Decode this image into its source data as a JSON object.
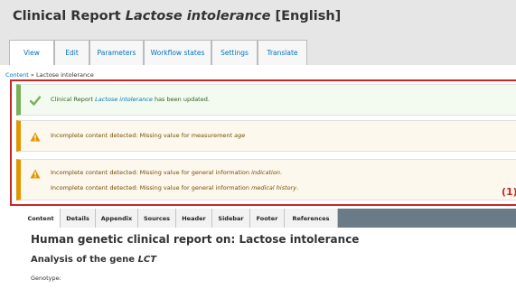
{
  "header": {
    "title_prefix": "Clinical Report ",
    "title_emphasis": "Lactose intolerance",
    "title_suffix": " [English]"
  },
  "tabs": [
    {
      "label": "View",
      "active": true
    },
    {
      "label": "Edit"
    },
    {
      "label": "Parameters"
    },
    {
      "label": "Workflow states"
    },
    {
      "label": "Settings"
    },
    {
      "label": "Translate"
    }
  ],
  "breadcrumb": {
    "link": "Content",
    "separator": " » ",
    "current": "Lactose intolerance"
  },
  "messages": {
    "status": {
      "prefix": "Clinical Report ",
      "emphasis": "Lactose intolerance",
      "suffix": " has been updated."
    },
    "warning1": {
      "prefix": "Incomplete content detected: Missing value for measurement ",
      "emphasis": "age"
    },
    "warning2_line1": {
      "prefix": "Incomplete content detected: Missing value for general information ",
      "emphasis": "indication",
      "suffix": "."
    },
    "warning2_line2": {
      "prefix": "Incomplete content detected: Missing value for general information ",
      "emphasis": "medical history",
      "suffix": "."
    }
  },
  "annotation": "(1)",
  "content_tabs": [
    "Content",
    "Details",
    "Appendix",
    "Sources",
    "Header",
    "Sidebar",
    "Footer",
    "References"
  ],
  "report": {
    "title": "Human genetic clinical report on: Lactose intolerance",
    "gene_prefix": "Analysis of the gene ",
    "gene_name": "LCT",
    "genotype_label": "Genotype:"
  },
  "colors": {
    "link": "#0074bd",
    "status_accent": "#77b259",
    "warning_accent": "#e09600",
    "highlight": "#c62828"
  },
  "icons": {
    "status": "checkmark-icon",
    "warning": "warning-triangle-icon"
  }
}
